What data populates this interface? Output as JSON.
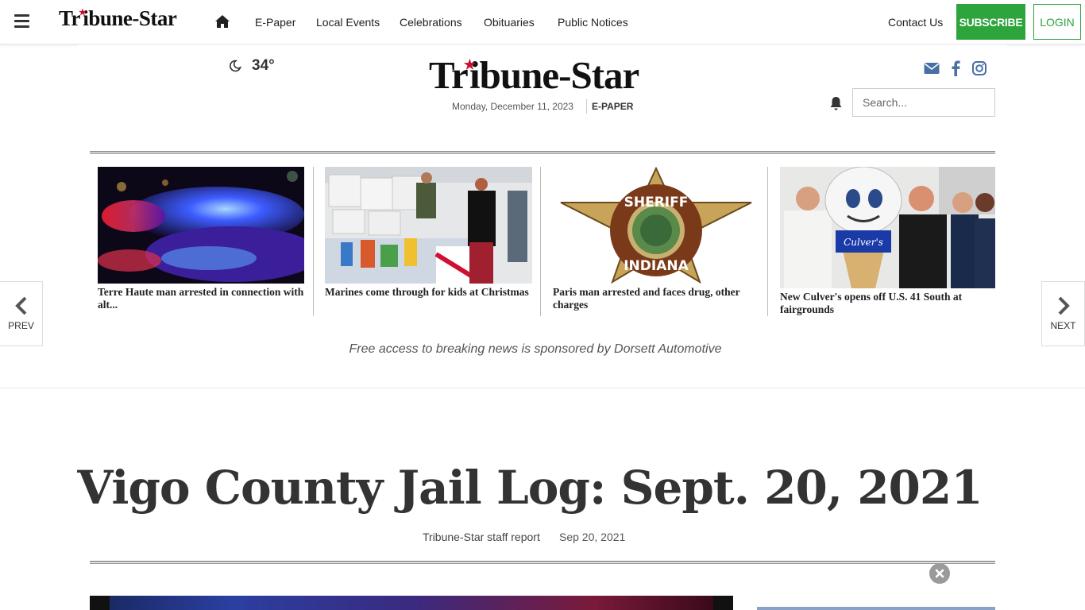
{
  "topbar": {
    "logo": "Tribune-Star",
    "nav": [
      "E-Paper",
      "Local Events",
      "Celebrations",
      "Obituaries",
      "Public Notices"
    ],
    "contact": "Contact Us",
    "subscribe": "SUBSCRIBE",
    "login": "LOGIN"
  },
  "masthead": {
    "temperature": "34°",
    "logo": "Tribune-Star",
    "date": "Monday, December 11, 2023",
    "epaper": "E-PAPER",
    "search_placeholder": "Search..."
  },
  "carousel": {
    "items": [
      {
        "title": "Terre Haute man arrested in connection with alt..."
      },
      {
        "title": "Marines come through for kids at Christmas"
      },
      {
        "title": "Paris man arrested and faces drug, other charges",
        "badge_top": "SHERIFF",
        "badge_bottom": "INDIANA"
      },
      {
        "title": "New Culver's opens off U.S. 41 South at fairgrounds",
        "cone_label": "Culver's"
      }
    ],
    "prev": "PREV",
    "next": "NEXT",
    "sponsor": "Free access to breaking news is sponsored by Dorsett Automotive"
  },
  "article": {
    "headline": "Vigo County Jail Log: Sept. 20, 2021",
    "byline": "Tribune-Star staff report",
    "date": "Sep 20, 2021"
  },
  "colors": {
    "accent_green": "#2ea43d",
    "logo_star_red": "#c8102e",
    "social_blue": "#4a6fa5"
  }
}
